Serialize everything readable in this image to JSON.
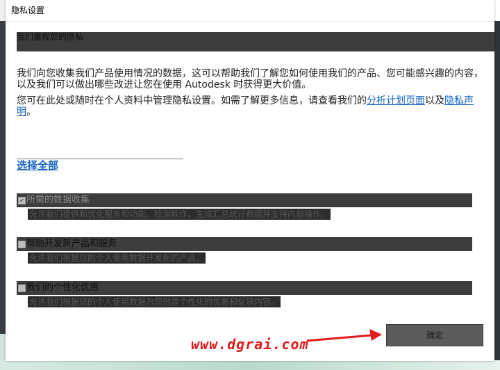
{
  "window": {
    "title": "隐私设置"
  },
  "header": {
    "title": "我们重视您的隐私"
  },
  "intro": {
    "paragraph1": "我们向您收集我们产品使用情况的数据，这可以帮助我们了解您如何使用我们的产品、您可能感兴趣的内容，以及我们可以做出哪些改进让您在使用 Autodesk 时获得更大价值。",
    "paragraph2_before": "您可在此处或随时在个人资料中管理隐私设置。如需了解更多信息，请查看我们的",
    "link_analytics": "分析计划页面",
    "paragraph2_middle": "以及",
    "link_privacy": "隐私声明",
    "paragraph2_after": "。"
  },
  "select_all": "选择全部",
  "options": [
    {
      "label": "所需的数据收集",
      "description": "允许我们提供和优化服务和功能、检测欺诈、生成汇总统计数据并支持内部操作。",
      "checked": true,
      "disabled": true
    },
    {
      "label": "帮助开发新产品和服务",
      "description": "允许我们根据您的个人使用数据开发新的产品。",
      "checked": false,
      "disabled": false
    },
    {
      "label": "我们的个性化优惠",
      "description": "允许我们根据您的个人使用数据为您创建个性化的优惠和促销内容。",
      "checked": false,
      "disabled": false
    }
  ],
  "ok_button": "确定",
  "watermark": "www.dgrai.com",
  "colors": {
    "link": "#1565c0",
    "watermark": "#e01b1b",
    "band": "#3d3d3d"
  }
}
